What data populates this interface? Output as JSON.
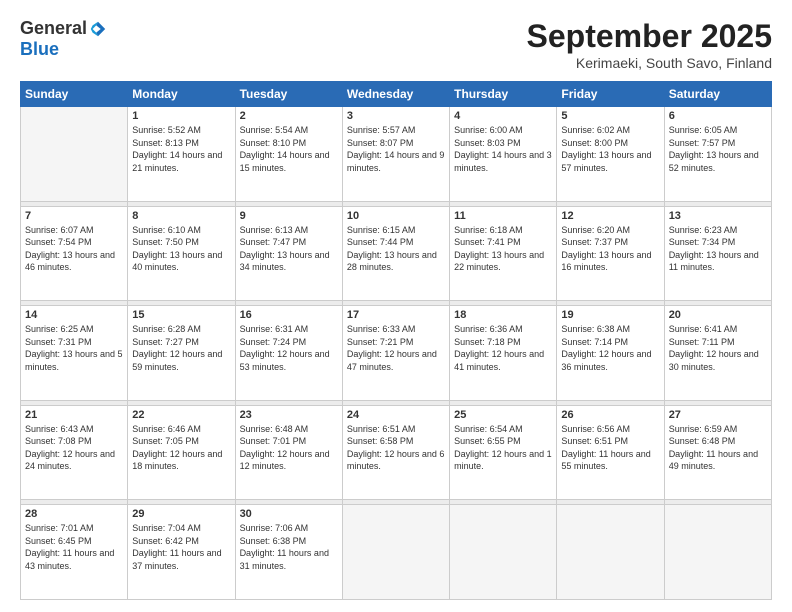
{
  "logo": {
    "general": "General",
    "blue": "Blue"
  },
  "title": "September 2025",
  "location": "Kerimaeki, South Savo, Finland",
  "weekdays": [
    "Sunday",
    "Monday",
    "Tuesday",
    "Wednesday",
    "Thursday",
    "Friday",
    "Saturday"
  ],
  "weeks": [
    [
      {
        "num": "",
        "sunrise": "",
        "sunset": "",
        "daylight": ""
      },
      {
        "num": "1",
        "sunrise": "Sunrise: 5:52 AM",
        "sunset": "Sunset: 8:13 PM",
        "daylight": "Daylight: 14 hours and 21 minutes."
      },
      {
        "num": "2",
        "sunrise": "Sunrise: 5:54 AM",
        "sunset": "Sunset: 8:10 PM",
        "daylight": "Daylight: 14 hours and 15 minutes."
      },
      {
        "num": "3",
        "sunrise": "Sunrise: 5:57 AM",
        "sunset": "Sunset: 8:07 PM",
        "daylight": "Daylight: 14 hours and 9 minutes."
      },
      {
        "num": "4",
        "sunrise": "Sunrise: 6:00 AM",
        "sunset": "Sunset: 8:03 PM",
        "daylight": "Daylight: 14 hours and 3 minutes."
      },
      {
        "num": "5",
        "sunrise": "Sunrise: 6:02 AM",
        "sunset": "Sunset: 8:00 PM",
        "daylight": "Daylight: 13 hours and 57 minutes."
      },
      {
        "num": "6",
        "sunrise": "Sunrise: 6:05 AM",
        "sunset": "Sunset: 7:57 PM",
        "daylight": "Daylight: 13 hours and 52 minutes."
      }
    ],
    [
      {
        "num": "7",
        "sunrise": "Sunrise: 6:07 AM",
        "sunset": "Sunset: 7:54 PM",
        "daylight": "Daylight: 13 hours and 46 minutes."
      },
      {
        "num": "8",
        "sunrise": "Sunrise: 6:10 AM",
        "sunset": "Sunset: 7:50 PM",
        "daylight": "Daylight: 13 hours and 40 minutes."
      },
      {
        "num": "9",
        "sunrise": "Sunrise: 6:13 AM",
        "sunset": "Sunset: 7:47 PM",
        "daylight": "Daylight: 13 hours and 34 minutes."
      },
      {
        "num": "10",
        "sunrise": "Sunrise: 6:15 AM",
        "sunset": "Sunset: 7:44 PM",
        "daylight": "Daylight: 13 hours and 28 minutes."
      },
      {
        "num": "11",
        "sunrise": "Sunrise: 6:18 AM",
        "sunset": "Sunset: 7:41 PM",
        "daylight": "Daylight: 13 hours and 22 minutes."
      },
      {
        "num": "12",
        "sunrise": "Sunrise: 6:20 AM",
        "sunset": "Sunset: 7:37 PM",
        "daylight": "Daylight: 13 hours and 16 minutes."
      },
      {
        "num": "13",
        "sunrise": "Sunrise: 6:23 AM",
        "sunset": "Sunset: 7:34 PM",
        "daylight": "Daylight: 13 hours and 11 minutes."
      }
    ],
    [
      {
        "num": "14",
        "sunrise": "Sunrise: 6:25 AM",
        "sunset": "Sunset: 7:31 PM",
        "daylight": "Daylight: 13 hours and 5 minutes."
      },
      {
        "num": "15",
        "sunrise": "Sunrise: 6:28 AM",
        "sunset": "Sunset: 7:27 PM",
        "daylight": "Daylight: 12 hours and 59 minutes."
      },
      {
        "num": "16",
        "sunrise": "Sunrise: 6:31 AM",
        "sunset": "Sunset: 7:24 PM",
        "daylight": "Daylight: 12 hours and 53 minutes."
      },
      {
        "num": "17",
        "sunrise": "Sunrise: 6:33 AM",
        "sunset": "Sunset: 7:21 PM",
        "daylight": "Daylight: 12 hours and 47 minutes."
      },
      {
        "num": "18",
        "sunrise": "Sunrise: 6:36 AM",
        "sunset": "Sunset: 7:18 PM",
        "daylight": "Daylight: 12 hours and 41 minutes."
      },
      {
        "num": "19",
        "sunrise": "Sunrise: 6:38 AM",
        "sunset": "Sunset: 7:14 PM",
        "daylight": "Daylight: 12 hours and 36 minutes."
      },
      {
        "num": "20",
        "sunrise": "Sunrise: 6:41 AM",
        "sunset": "Sunset: 7:11 PM",
        "daylight": "Daylight: 12 hours and 30 minutes."
      }
    ],
    [
      {
        "num": "21",
        "sunrise": "Sunrise: 6:43 AM",
        "sunset": "Sunset: 7:08 PM",
        "daylight": "Daylight: 12 hours and 24 minutes."
      },
      {
        "num": "22",
        "sunrise": "Sunrise: 6:46 AM",
        "sunset": "Sunset: 7:05 PM",
        "daylight": "Daylight: 12 hours and 18 minutes."
      },
      {
        "num": "23",
        "sunrise": "Sunrise: 6:48 AM",
        "sunset": "Sunset: 7:01 PM",
        "daylight": "Daylight: 12 hours and 12 minutes."
      },
      {
        "num": "24",
        "sunrise": "Sunrise: 6:51 AM",
        "sunset": "Sunset: 6:58 PM",
        "daylight": "Daylight: 12 hours and 6 minutes."
      },
      {
        "num": "25",
        "sunrise": "Sunrise: 6:54 AM",
        "sunset": "Sunset: 6:55 PM",
        "daylight": "Daylight: 12 hours and 1 minute."
      },
      {
        "num": "26",
        "sunrise": "Sunrise: 6:56 AM",
        "sunset": "Sunset: 6:51 PM",
        "daylight": "Daylight: 11 hours and 55 minutes."
      },
      {
        "num": "27",
        "sunrise": "Sunrise: 6:59 AM",
        "sunset": "Sunset: 6:48 PM",
        "daylight": "Daylight: 11 hours and 49 minutes."
      }
    ],
    [
      {
        "num": "28",
        "sunrise": "Sunrise: 7:01 AM",
        "sunset": "Sunset: 6:45 PM",
        "daylight": "Daylight: 11 hours and 43 minutes."
      },
      {
        "num": "29",
        "sunrise": "Sunrise: 7:04 AM",
        "sunset": "Sunset: 6:42 PM",
        "daylight": "Daylight: 11 hours and 37 minutes."
      },
      {
        "num": "30",
        "sunrise": "Sunrise: 7:06 AM",
        "sunset": "Sunset: 6:38 PM",
        "daylight": "Daylight: 11 hours and 31 minutes."
      },
      {
        "num": "",
        "sunrise": "",
        "sunset": "",
        "daylight": ""
      },
      {
        "num": "",
        "sunrise": "",
        "sunset": "",
        "daylight": ""
      },
      {
        "num": "",
        "sunrise": "",
        "sunset": "",
        "daylight": ""
      },
      {
        "num": "",
        "sunrise": "",
        "sunset": "",
        "daylight": ""
      }
    ]
  ]
}
